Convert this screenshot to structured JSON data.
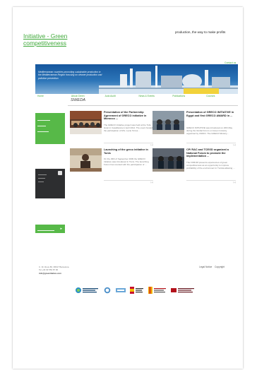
{
  "header": {
    "site_title_line1": "Initiative - Green",
    "site_title_line2": "competitiveness",
    "tagline": "production, the way to make profits",
    "contact_link": "Contact us"
  },
  "banner": {
    "text": "Mediterranean countries promoting sustainable production in the Mediterranean Region focusing on cleaner production and pollution prevention"
  },
  "nav": {
    "items": [
      "Home",
      "About Green",
      "Auto Audit",
      "News & Events",
      "Publications",
      "Courses"
    ]
  },
  "logo_text": "SWEDA",
  "news": [
    {
      "title": "Presentation of the Partnership Agreement of GRECO initiative in Morocco ...",
      "excerpt": "The GRECO Initiative project was held at the Tufa Hotel in Casablanca in April 2014. The event hosted the participation of Mrs. Lucie Torres...",
      "more": "(+)"
    },
    {
      "title": "Presentation of GRECO INITIATIVE in Egypt and first GRECO AWARD in ...",
      "excerpt": "GRECO INITIATIVE was introduced on 26th May during the Global Forum on Green Industry organized by UNIDO. The GRECO Ministry...",
      "more": "(+)"
    },
    {
      "title": "Launching of the greco initiative in Tunis",
      "excerpt": "On the 29th of September 2009 the GRECO Initiative was introduced in Tunis. The launching Forum has counted with the participation of ...",
      "more": "(+)"
    },
    {
      "title": "CP/ RAC and TCEGD organized a National Forum to promote the implementation ...",
      "excerpt": "The FORUM presents experiences of green competitiveness as an opportunity to improve profitability of the environment in Tunisia allowing ...",
      "more": "(+)"
    }
  ],
  "footer": {
    "address": "C. Dr. Roux 80, 08017 Barcelona",
    "phone": "Tel +34 93 553 87 90",
    "email": "info@greenitiative.com",
    "legal": "Legal Notice",
    "copyright": "Copyright"
  },
  "colors": {
    "accent_green": "#57b948",
    "link_green": "#3fa93a",
    "dark_box": "#2d2e30",
    "banner_blue": "#1f6aad"
  }
}
